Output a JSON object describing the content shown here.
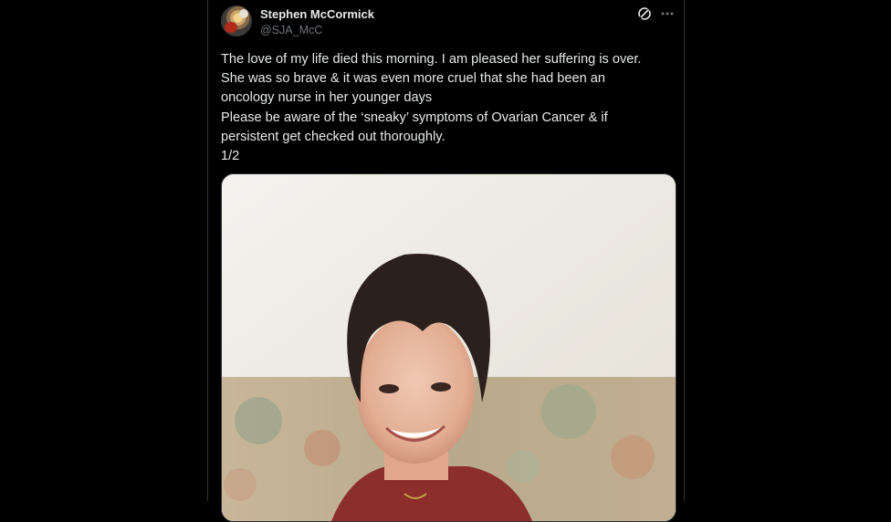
{
  "tweet": {
    "author_name": "Stephen McCormick",
    "author_handle": "@SJA_McC",
    "text_lines": [
      "The love of my life died this morning. I am pleased her suffering is over.",
      "She was so brave & it was even more cruel that she had been an",
      "oncology nurse in her younger days",
      "Please be aware of the ‘sneaky’ symptoms of Ovarian Cancer & if",
      "persistent get checked out thoroughly.",
      "1/2"
    ],
    "photo_description_icon": "photo-of-woman-smiling"
  },
  "icons": {
    "grok": "grok-icon",
    "more": "more-icon",
    "avatar": "avatar"
  },
  "colors": {
    "background": "#000000",
    "text": "#e7e9ea",
    "secondary_text": "#71767b",
    "border": "#2f3336"
  }
}
